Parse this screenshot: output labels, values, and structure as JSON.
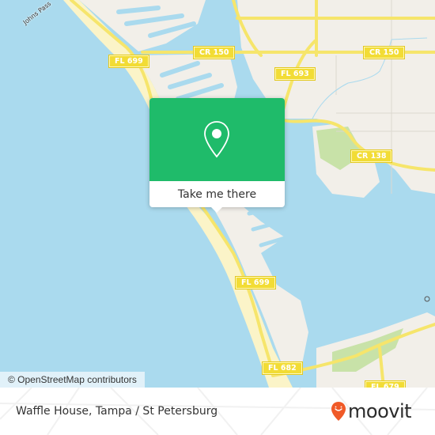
{
  "map": {
    "place_labels": [
      {
        "name": "johns-pass-label",
        "text": "Johns Pass"
      }
    ],
    "road_shields": [
      {
        "name": "fl-699-shield-north",
        "text": "FL 699"
      },
      {
        "name": "cr-150-shield-west",
        "text": "CR 150"
      },
      {
        "name": "cr-150-shield-east",
        "text": "CR 150"
      },
      {
        "name": "fl-693-shield",
        "text": "FL 693"
      },
      {
        "name": "cr-138-shield",
        "text": "CR 138"
      },
      {
        "name": "fl-699-shield-south",
        "text": "FL 699"
      },
      {
        "name": "fl-682-shield",
        "text": "FL 682"
      },
      {
        "name": "fl-679-shield",
        "text": "FL 679"
      }
    ],
    "attribution": "© OpenStreetMap contributors",
    "colors": {
      "water": "#aadaee",
      "land": "#f2efe9",
      "beach": "#fbf4c8",
      "park": "#c8e2a8",
      "road": "#f6e56b"
    }
  },
  "popup": {
    "button_label": "Take me there",
    "icon": "map-pin-icon",
    "color": "#1fbb6a"
  },
  "footer": {
    "place_title": "Waffle House, Tampa / St Petersburg",
    "brand": "moovit",
    "brand_color": "#f05a28"
  }
}
